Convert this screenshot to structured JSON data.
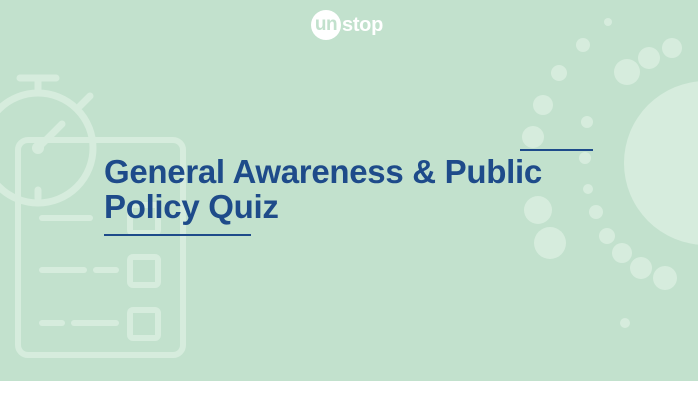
{
  "brand": {
    "logo_circle_text": "un",
    "logo_rest_text": "stop"
  },
  "banner": {
    "title_line1": "General Awareness & Public",
    "title_line2": "Policy Quiz"
  },
  "colors": {
    "background": "#c2e1cd",
    "title": "#1e4b8a",
    "decor_light": "#d9eee0"
  },
  "icons": [
    "stopwatch-icon",
    "checklist-clipboard-icon",
    "dot-arc-decoration"
  ]
}
